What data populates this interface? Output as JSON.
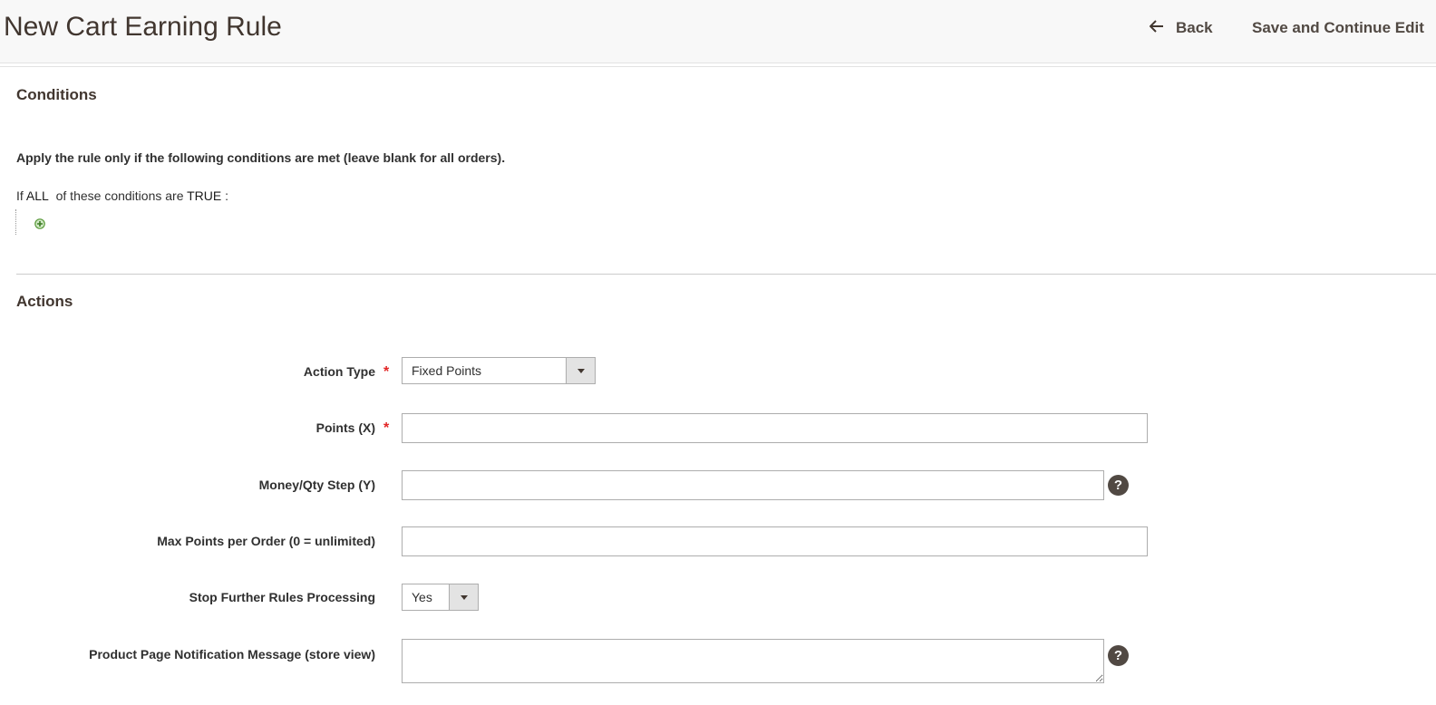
{
  "header": {
    "title": "New Cart Earning Rule",
    "back_label": "Back",
    "save_continue_label": "Save and Continue Edit"
  },
  "conditions": {
    "title": "Conditions",
    "hint": "Apply the rule only if the following conditions are met (leave blank for all orders).",
    "line": {
      "prefix": "If",
      "aggregator": "ALL",
      "middle": "of these conditions are",
      "value": "TRUE",
      "suffix": ":"
    },
    "add_icon": "add-condition-icon"
  },
  "actions": {
    "title": "Actions",
    "fields": {
      "action_type": {
        "label": "Action Type",
        "required": "*",
        "selected": "Fixed Points"
      },
      "points": {
        "label": "Points (X)",
        "required": "*",
        "value": ""
      },
      "money_step": {
        "label": "Money/Qty Step (Y)",
        "value": "",
        "help": "?"
      },
      "max_points": {
        "label": "Max Points per Order (0 = unlimited)",
        "value": ""
      },
      "stop_processing": {
        "label": "Stop Further Rules Processing",
        "selected": "Yes"
      },
      "notification": {
        "label": "Product Page Notification Message (store view)",
        "value": "",
        "help": "?"
      }
    }
  },
  "colors": {
    "required": "#e22626",
    "help_bg": "#514943",
    "add_icon": "#5a9a3a"
  }
}
